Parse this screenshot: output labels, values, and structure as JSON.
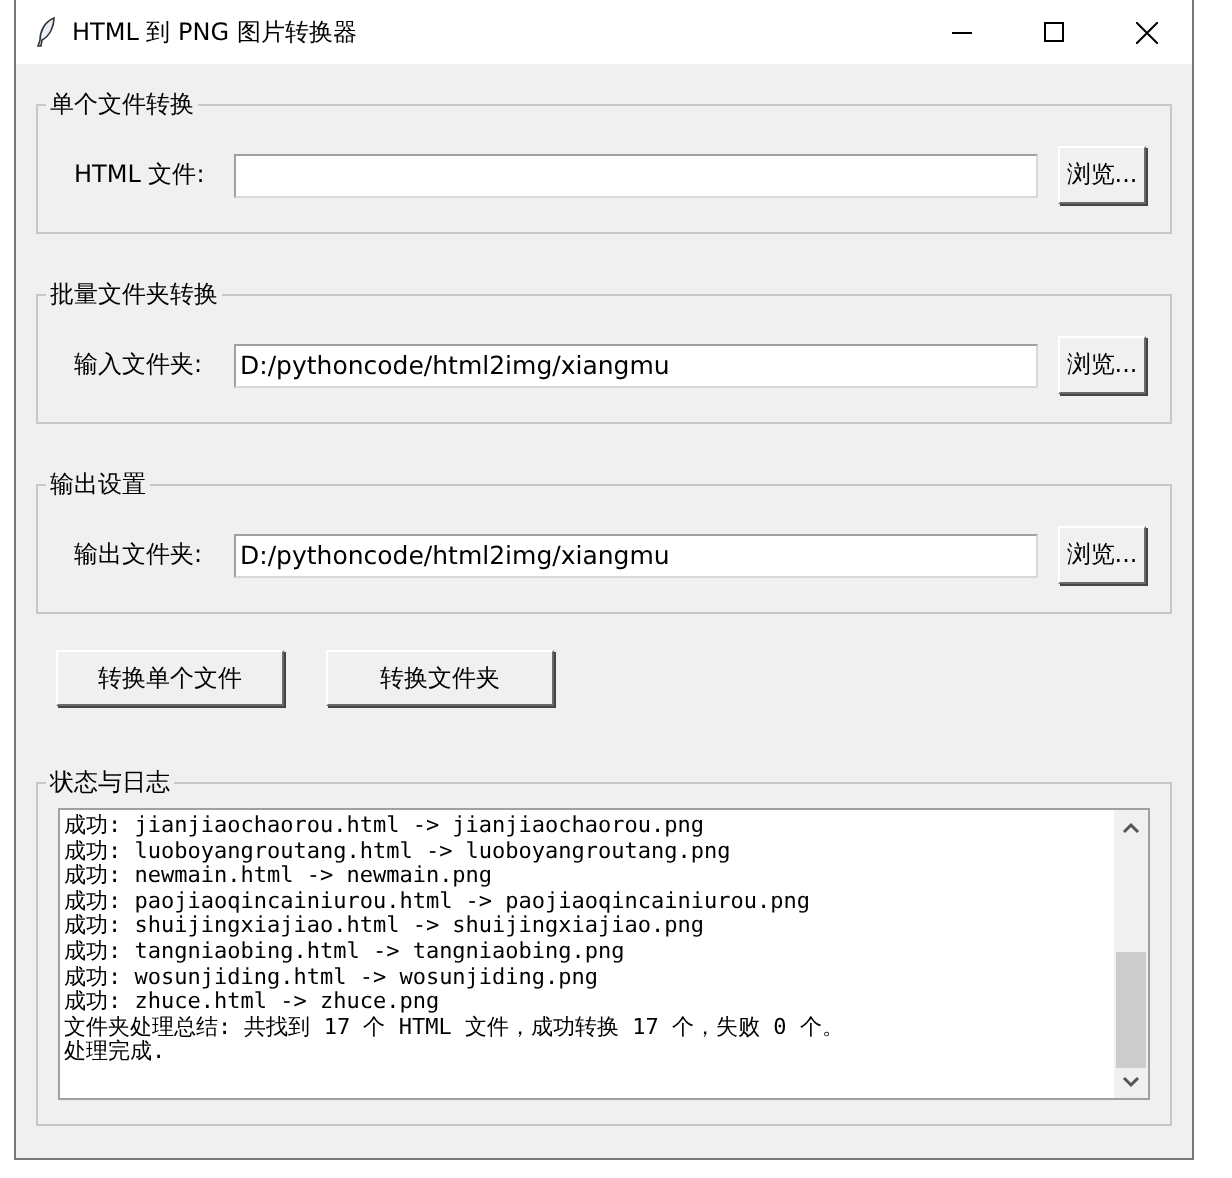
{
  "window": {
    "title": "HTML 到 PNG 图片转换器"
  },
  "groups": [
    {
      "title": "单个文件转换",
      "field": {
        "label": "HTML 文件:"
      },
      "button": "浏览..."
    },
    {
      "title": "批量文件夹转换",
      "field": {
        "label": "输入文件夹:",
        "value": "D:/pythoncode/html2img/xiangmu"
      },
      "button": "浏览..."
    },
    {
      "title": "输出设置",
      "field": {
        "label": "输出文件夹:",
        "value": "D:/pythoncode/html2img/xiangmu"
      },
      "button": "浏览..."
    }
  ],
  "actions": [
    "转换单个文件",
    "转换文件夹"
  ],
  "log": {
    "title": "状态与日志",
    "lines": [
      "成功: jianjiaochaorou.html -> jianjiaochaorou.png",
      "成功: luoboyangroutang.html -> luoboyangroutang.png",
      "成功: newmain.html -> newmain.png",
      "成功: paojiaoqincainiurou.html -> paojiaoqincainiurou.png",
      "成功: shuijingxiajiao.html -> shuijingxiajiao.png",
      "成功: tangniaobing.html -> tangniaobing.png",
      "成功: wosunjiding.html -> wosunjiding.png",
      "成功: zhuce.html -> zhuce.png",
      "文件夹处理总结: 共找到 17 个 HTML 文件，成功转换 17 个，失败 0 个。",
      "处理完成."
    ]
  }
}
